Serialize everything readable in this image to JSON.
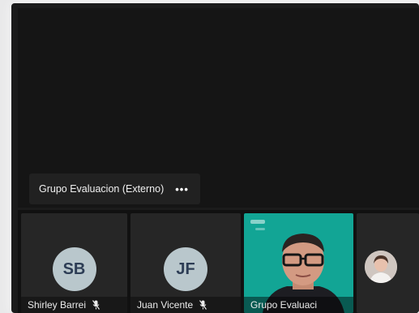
{
  "stage": {
    "speaker_label": "Grupo Evaluacion (Externo)",
    "more_label": "•••"
  },
  "participants": [
    {
      "initials": "SB",
      "name": "Shirley Barrei",
      "muted": true
    },
    {
      "initials": "JF",
      "name": "Juan Vicente",
      "muted": true
    },
    {
      "name": "Grupo Evaluaci",
      "video": true
    },
    {
      "avatar": "profile-photo"
    }
  ],
  "colors": {
    "background": "#1b1b1b",
    "tile": "#262626",
    "video_tile": "#12a595",
    "avatar_bg": "#b9c7cc",
    "avatar_text": "#2d3d55"
  }
}
